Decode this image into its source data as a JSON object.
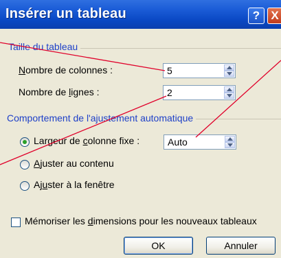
{
  "window": {
    "title": "Insérer un tableau",
    "help_glyph": "?",
    "close_glyph": "X"
  },
  "table_size": {
    "group_title": "Taille du tableau",
    "columns_label_pre": "",
    "columns_label_mnemonic": "N",
    "columns_label_post": "ombre de colonnes :",
    "columns_value": "5",
    "rows_label_pre": "Nombre de ",
    "rows_label_mnemonic": "l",
    "rows_label_post": "ignes :",
    "rows_value": "2"
  },
  "autofit": {
    "group_title": "Comportement de l'ajustement automatique",
    "fixed_width_pre": "Largeur de ",
    "fixed_width_mnemonic": "c",
    "fixed_width_post": "olonne fixe :",
    "fixed_width_value": "Auto",
    "fit_contents_pre": "",
    "fit_contents_mnemonic": "A",
    "fit_contents_post": "juster au contenu",
    "fit_window_pre": "Aj",
    "fit_window_mnemonic": "u",
    "fit_window_post": "ster à la fenêtre",
    "selected_option": "fixed_width"
  },
  "remember": {
    "label_pre": "Mémoriser les ",
    "label_mnemonic": "d",
    "label_post": "imensions pour les nouveaux tableaux",
    "checked": false
  },
  "buttons": {
    "ok": "OK",
    "cancel": "Annuler"
  },
  "colors": {
    "titlebar": "#0a48c4",
    "group_title": "#1e40c8",
    "annotation_line": "#e0002a",
    "radio_selected": "#2aa02a"
  }
}
